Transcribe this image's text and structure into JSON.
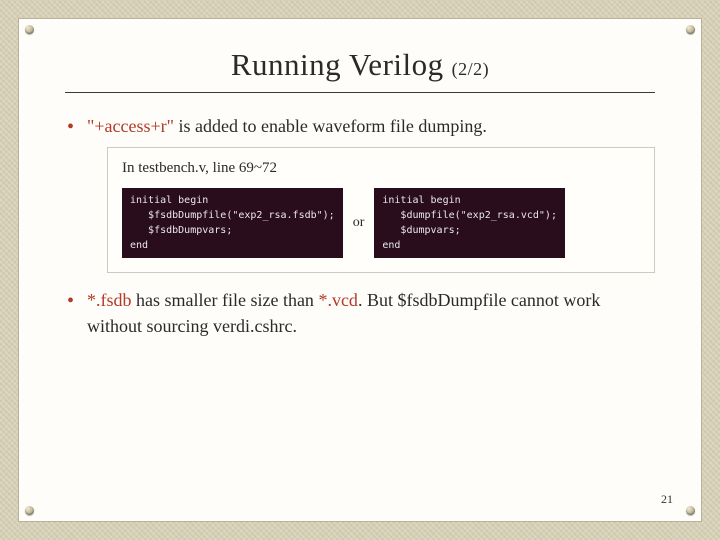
{
  "title": "Running Verilog",
  "title_suffix": "(2/2)",
  "bullets": [
    {
      "prefix_red": "\"+access+r\"",
      "rest": " is added to enable waveform file dumping."
    },
    {
      "parts": [
        {
          "cls": "red",
          "text": "*.fsdb"
        },
        {
          "cls": "",
          "text": " has smaller file size than "
        },
        {
          "cls": "red",
          "text": "*.vcd"
        },
        {
          "cls": "",
          "text": ". But $fsdbDumpfile cannot work without sourcing verdi.cshrc."
        }
      ]
    }
  ],
  "box_title": "In testbench.v, line 69~72",
  "code_left": "initial begin\n   $fsdbDumpfile(\"exp2_rsa.fsdb\");\n   $fsdbDumpvars;\nend",
  "code_right": "initial begin\n   $dumpfile(\"exp2_rsa.vcd\");\n   $dumpvars;\nend",
  "or_label": "or",
  "page_number": "21"
}
